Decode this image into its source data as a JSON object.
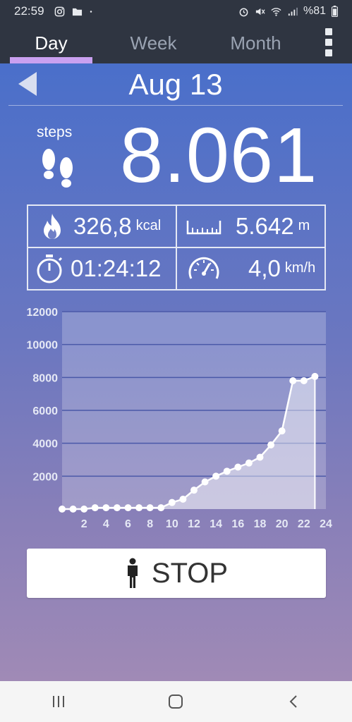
{
  "status_bar": {
    "time": "22:59",
    "battery": "%81"
  },
  "tabs": [
    {
      "label": "Day",
      "active": true
    },
    {
      "label": "Week",
      "active": false
    },
    {
      "label": "Month",
      "active": false
    }
  ],
  "date": "Aug 13",
  "steps": {
    "label": "steps",
    "value": "8.061"
  },
  "stats": {
    "calories": {
      "value": "326,8",
      "unit": "kcal",
      "icon": "flame-icon"
    },
    "distance": {
      "value": "5.642",
      "unit": "m",
      "icon": "ruler-icon"
    },
    "duration": {
      "value": "01:24:12",
      "icon": "stopwatch-icon"
    },
    "speed": {
      "value": "4,0",
      "unit": "km/h",
      "icon": "speedometer-icon"
    }
  },
  "colors": {
    "accent": "#c9a0f0",
    "header_bg": "#2f3541"
  },
  "chart_data": {
    "type": "area",
    "x": [
      0,
      1,
      2,
      3,
      4,
      5,
      6,
      7,
      8,
      9,
      10,
      11,
      12,
      13,
      14,
      15,
      16,
      17,
      18,
      19,
      20,
      21,
      22,
      23
    ],
    "values": [
      0,
      0,
      0,
      80,
      80,
      80,
      80,
      80,
      80,
      80,
      400,
      600,
      1150,
      1650,
      2000,
      2300,
      2550,
      2800,
      3150,
      3900,
      4750,
      7800,
      7800,
      8061
    ],
    "xticks": [
      "2",
      "4",
      "6",
      "8",
      "10",
      "12",
      "14",
      "16",
      "18",
      "20",
      "22",
      "24"
    ],
    "yticks": [
      "2000",
      "4000",
      "6000",
      "8000",
      "10000",
      "12000"
    ],
    "ylim": [
      0,
      12000
    ],
    "xlim": [
      0,
      24
    ],
    "grid": true
  },
  "stop_button": {
    "label": "STOP"
  }
}
